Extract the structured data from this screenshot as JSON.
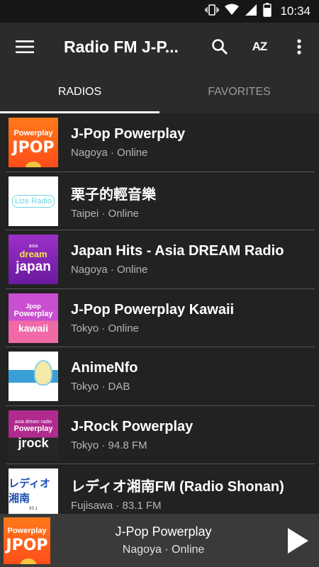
{
  "status_bar": {
    "time": "10:34"
  },
  "app_bar": {
    "title": "Radio FM J-P...",
    "sort_label": "AZ"
  },
  "tabs": [
    {
      "label": "RADIOS",
      "active": true
    },
    {
      "label": "FAVORITES",
      "active": false
    }
  ],
  "stations": [
    {
      "name": "J-Pop Powerplay",
      "info": "Nagoya · Online",
      "logo_text": [
        "Powerplay",
        "JPOP"
      ]
    },
    {
      "name": "栗子的輕音樂",
      "info": "Taipei · Online",
      "logo_text": [
        "Lize Radio"
      ]
    },
    {
      "name": "Japan Hits - Asia DREAM Radio",
      "info": "Nagoya · Online",
      "logo_text": [
        "asia",
        "dream",
        "japan"
      ]
    },
    {
      "name": "J-Pop Powerplay Kawaii",
      "info": "Tokyo · Online",
      "logo_text": [
        "Jpop",
        "Powerplay",
        "kawaii"
      ]
    },
    {
      "name": "AnimeNfo",
      "info": "Tokyo · DAB",
      "logo_text": []
    },
    {
      "name": "J-Rock Powerplay",
      "info": "Tokyo · 94.8 FM",
      "logo_text": [
        "asia dream radio",
        "Powerplay",
        "jrock"
      ]
    },
    {
      "name": "レディオ湘南FM (Radio Shonan)",
      "info": "Fujisawa · 83.1 FM",
      "logo_text": [
        "レディオ湘南",
        "83.1"
      ]
    }
  ],
  "player": {
    "name": "J-Pop Powerplay",
    "info": "Nagoya · Online",
    "logo_text": [
      "Powerplay",
      "JPOP"
    ]
  },
  "colors": {
    "background": "#222222",
    "app_bar": "#2b2b2b",
    "player": "#3a3a3a"
  }
}
